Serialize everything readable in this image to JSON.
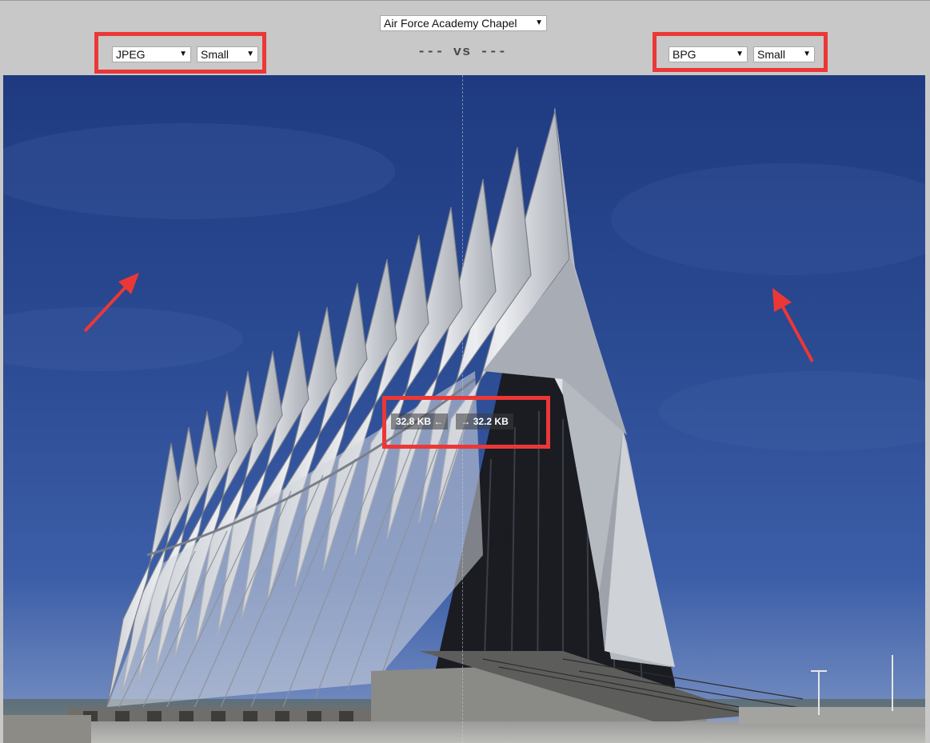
{
  "image_selector": {
    "selected": "Air Force Academy Chapel"
  },
  "left_panel": {
    "format": "JPEG",
    "size": "Small",
    "file_size": "32.8 KB",
    "arrow": "←"
  },
  "right_panel": {
    "format": "BPG",
    "size": "Small",
    "file_size": "32.2 KB",
    "arrow": "→"
  },
  "vs_label": "--- vs ---",
  "dropdown_icon": "triangle-down",
  "colors": {
    "highlight": "#ec3737",
    "background": "#c8c8c8"
  }
}
